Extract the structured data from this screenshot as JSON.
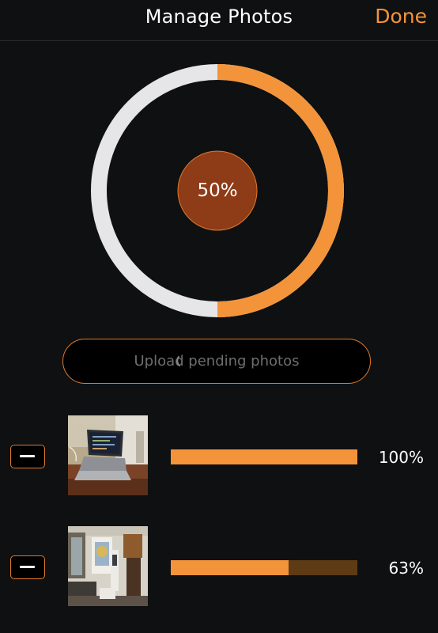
{
  "header": {
    "title": "Manage Photos",
    "done_label": "Done"
  },
  "overall": {
    "label": "50%",
    "fraction": 0.5
  },
  "upload_button": {
    "label": "Upload pending photos"
  },
  "photos": [
    {
      "percent_label": "100%",
      "fraction": 1.0
    },
    {
      "percent_label": "63%",
      "fraction": 0.63
    }
  ],
  "colors": {
    "accent": "#f3943a",
    "track": "#e6e6e8",
    "center": "#8e3b17",
    "bar_track": "#5e3b15",
    "background": "#0f1012"
  },
  "icons": {
    "remove": "minus-icon",
    "spinner": "spinner-icon"
  }
}
